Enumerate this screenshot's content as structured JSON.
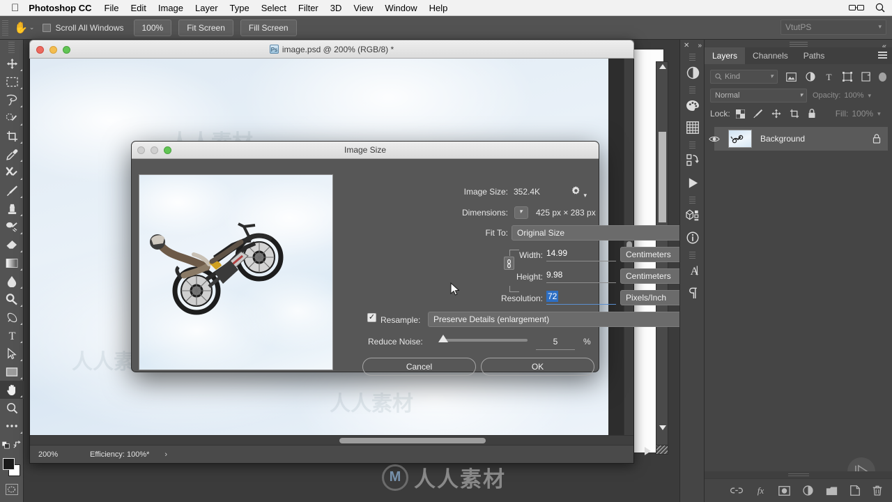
{
  "menubar": {
    "apple_icon": "apple-icon",
    "app_name": "Photoshop CC",
    "items": [
      "File",
      "Edit",
      "Image",
      "Layer",
      "Type",
      "Select",
      "Filter",
      "3D",
      "View",
      "Window",
      "Help"
    ],
    "right_icons": [
      "glasses-icon",
      "search-icon"
    ]
  },
  "options_bar": {
    "tool_icon": "hand-tool-icon",
    "tool_caret": "⌄",
    "scroll_all_windows_label": "Scroll All Windows",
    "scroll_all_windows_checked": false,
    "buttons": [
      "100%",
      "Fit Screen",
      "Fill Screen"
    ],
    "workspace": "VtutPS"
  },
  "toolbox": {
    "tools": [
      {
        "name": "move-tool",
        "selected": false
      },
      {
        "name": "rectangular-marquee-tool",
        "selected": false
      },
      {
        "name": "lasso-tool",
        "selected": false
      },
      {
        "name": "quick-selection-tool",
        "selected": false
      },
      {
        "name": "crop-tool",
        "selected": false
      },
      {
        "name": "eyedropper-tool",
        "selected": false
      },
      {
        "name": "healing-brush-tool",
        "selected": false
      },
      {
        "name": "brush-tool",
        "selected": false
      },
      {
        "name": "clone-stamp-tool",
        "selected": false
      },
      {
        "name": "history-brush-tool",
        "selected": false
      },
      {
        "name": "eraser-tool",
        "selected": false
      },
      {
        "name": "gradient-tool",
        "selected": false
      },
      {
        "name": "blur-tool",
        "selected": false
      },
      {
        "name": "dodge-tool",
        "selected": false
      },
      {
        "name": "pen-tool",
        "selected": false
      },
      {
        "name": "type-tool",
        "selected": false
      },
      {
        "name": "path-selection-tool",
        "selected": false
      },
      {
        "name": "rectangle-tool",
        "selected": false
      },
      {
        "name": "hand-tool",
        "selected": true
      },
      {
        "name": "zoom-tool",
        "selected": false
      },
      {
        "name": "edit-toolbar-tool",
        "selected": false
      }
    ],
    "foreground_color": "#1a1a1a",
    "background_color": "#ffffff"
  },
  "document": {
    "title": "image.psd @ 200% (RGB/8) *",
    "badge": "Ps",
    "status": {
      "zoom": "200%",
      "efficiency": "Efficiency: 100%*",
      "arrow": "›"
    }
  },
  "dialog": {
    "title": "Image Size",
    "gear_icon": "gear-icon",
    "image_size_label": "Image Size:",
    "image_size_value": "352.4K",
    "dimensions_label": "Dimensions:",
    "dimensions_value": "425 px × 283 px",
    "dimensions_caret": "⌄",
    "fit_to_label": "Fit To:",
    "fit_to_value": "Original Size",
    "width_label": "Width:",
    "width_value": "14.99",
    "width_unit": "Centimeters",
    "height_label": "Height:",
    "height_value": "9.98",
    "height_unit": "Centimeters",
    "chain_icon": "link-constrain-icon",
    "resolution_label": "Resolution:",
    "resolution_value": "72",
    "resolution_unit": "Pixels/Inch",
    "resample_label": "Resample:",
    "resample_checked": true,
    "resample_value": "Preserve Details (enlargement)",
    "reduce_noise_label": "Reduce Noise:",
    "reduce_noise_value": "5",
    "reduce_noise_unit": "%",
    "cancel_label": "Cancel",
    "ok_label": "OK",
    "preview_alt": "motocross-rider-preview"
  },
  "dock": {
    "close_icon": "close-icon",
    "collapse_icon": "collapse-icon",
    "icons": [
      "adjustments-icon",
      "color-icon",
      "swatches-icon",
      "actions-icon",
      "timeline-play-icon",
      "3d-icon",
      "info-icon",
      "character-icon",
      "paragraph-icon"
    ]
  },
  "layers_panel": {
    "collapse_icon": "collapse-icon",
    "tabs": [
      {
        "label": "Layers",
        "active": true
      },
      {
        "label": "Channels",
        "active": false
      },
      {
        "label": "Paths",
        "active": false
      }
    ],
    "menu_icon": "panel-menu-icon",
    "filter": {
      "kind_label": "Kind",
      "search_icon": "search-icon",
      "caret": "⌄",
      "icons": [
        "image-filter-icon",
        "adjustment-filter-icon",
        "type-filter-icon",
        "shape-filter-icon",
        "smart-object-filter-icon"
      ],
      "toggle": "filter-toggle-icon"
    },
    "blend_mode": "Normal",
    "blend_caret": "⌄",
    "opacity_label": "Opacity:",
    "opacity_value": "100%",
    "lock_label": "Lock:",
    "lock_icons": [
      "lock-transparent-icon",
      "lock-image-icon",
      "lock-position-icon",
      "lock-artboard-icon",
      "lock-all-icon"
    ],
    "fill_label": "Fill:",
    "fill_value": "100%",
    "layers": [
      {
        "name": "Background",
        "visible": true,
        "locked": true,
        "thumb": "sky-motocross-thumb"
      }
    ],
    "bottom_icons": [
      "link-layers-icon",
      "layer-style-fx-icon",
      "layer-mask-icon",
      "adjustment-layer-icon",
      "new-group-icon",
      "new-layer-icon",
      "delete-layer-icon"
    ],
    "play_icon": "play-preview-icon"
  },
  "watermark": {
    "text": "人人素材",
    "logo": "M",
    "canvas_marks": [
      "人人素材",
      "人人素材",
      "人人素材",
      "人人素材",
      "人人素材",
      "人人素材"
    ]
  },
  "colors": {
    "panel_bg": "#454545",
    "toolbar_bg": "#535353",
    "canvas_bg": "#3b3b3b",
    "dialog_bg": "#575757",
    "accent": "#2d8ceb"
  }
}
